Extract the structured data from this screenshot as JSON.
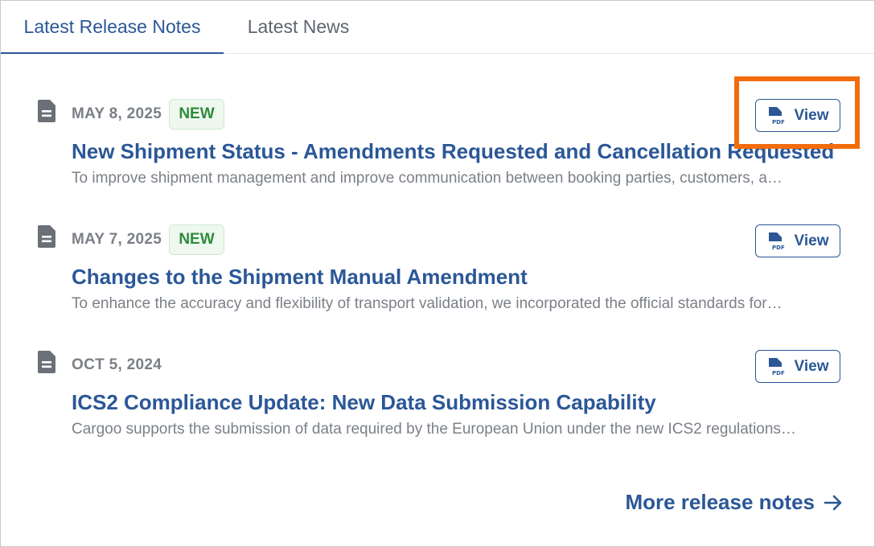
{
  "tabs": [
    {
      "label": "Latest Release Notes",
      "active": true
    },
    {
      "label": "Latest News",
      "active": false
    }
  ],
  "items": [
    {
      "date": "MAY 8, 2025",
      "badge": "NEW",
      "title": "New Shipment Status - Amendments Requested and Cancellation Requested",
      "description": "To improve shipment management and improve communication between booking parties, customers, a…",
      "view_label": "View",
      "icon": "document-icon"
    },
    {
      "date": "MAY 7, 2025",
      "badge": "NEW",
      "title": "Changes to the Shipment Manual Amendment",
      "description": "To enhance the accuracy and flexibility of transport validation, we incorporated the official standards for…",
      "view_label": "View",
      "icon": "document-icon"
    },
    {
      "date": "OCT 5, 2024",
      "badge": "",
      "title": "ICS2 Compliance Update: New Data Submission Capability",
      "description": "Cargoo supports the submission of data required by the European Union under the new ICS2 regulations…",
      "view_label": "View",
      "icon": "document-icon"
    }
  ],
  "more_link": {
    "label": "More release notes",
    "icon": "arrow-right-icon"
  },
  "colors": {
    "accent": "#2b5797",
    "badge_green": "#2e8b3a",
    "highlight": "#f26c0d"
  }
}
